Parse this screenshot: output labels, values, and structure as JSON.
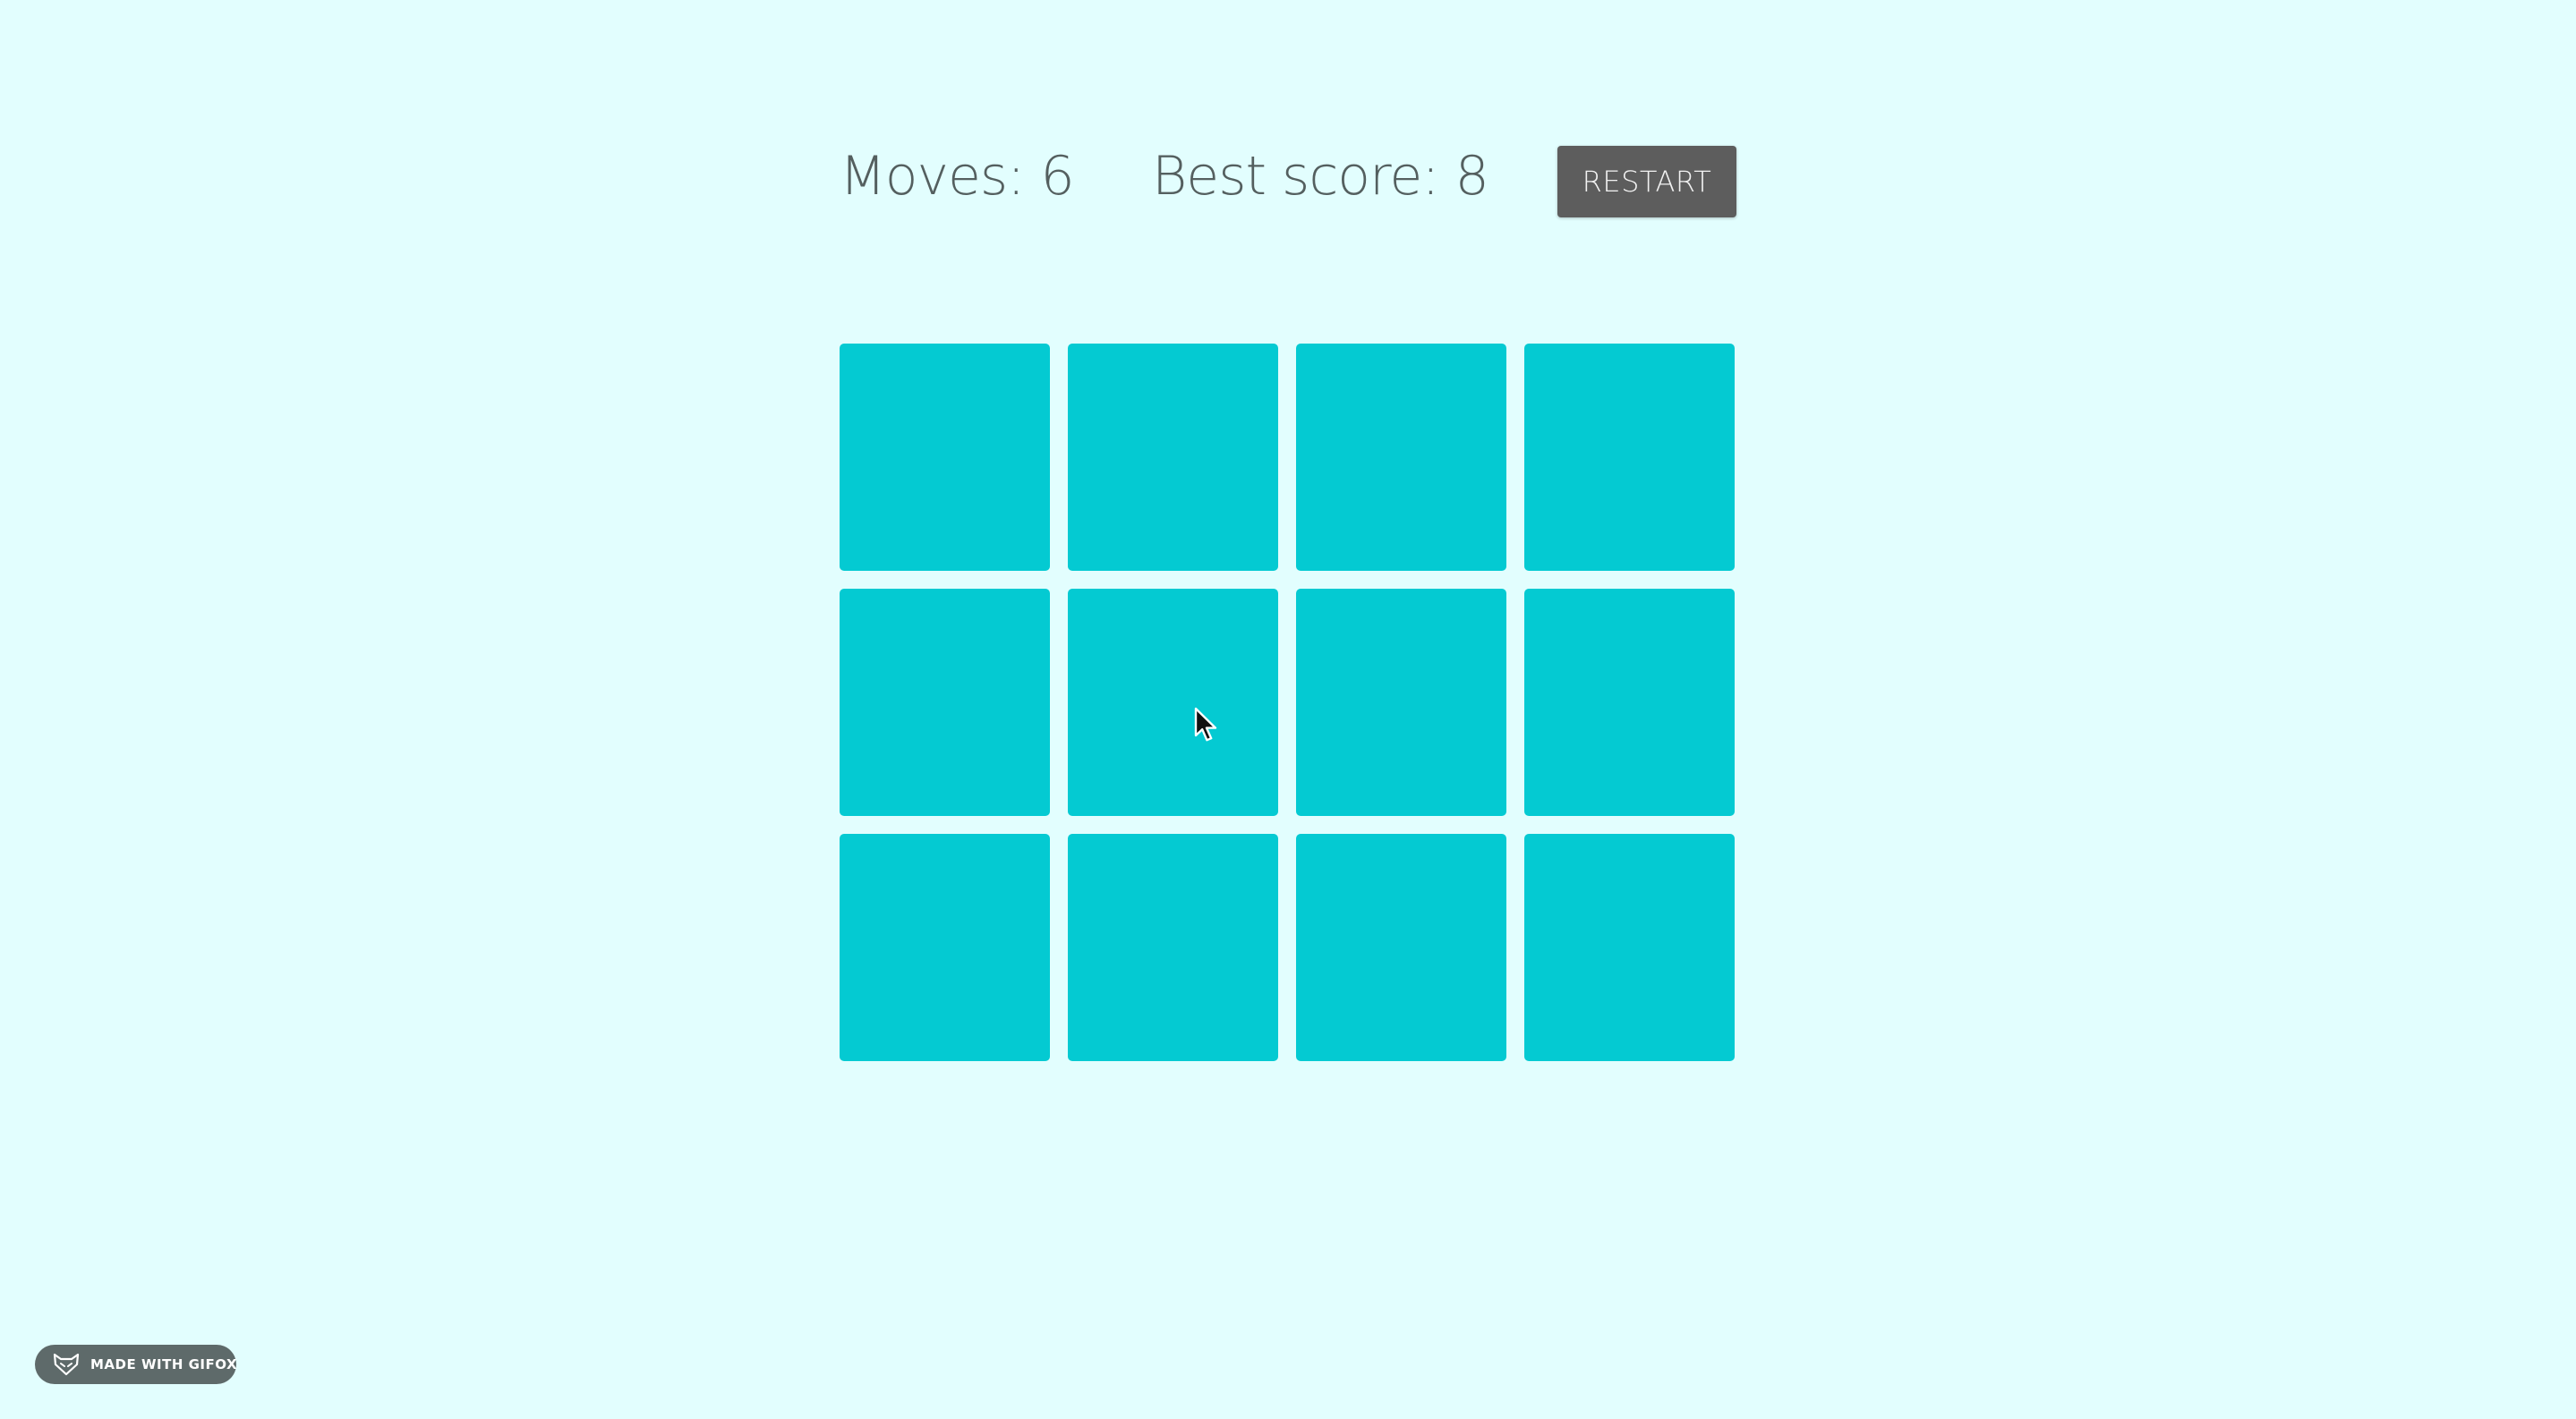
{
  "scoreboard": {
    "moves_text": "Moves: 6",
    "best_score_text": "Best score: 8",
    "restart_label": "RESTART"
  },
  "board": {
    "rows": 3,
    "columns": 4,
    "cards": [
      {
        "state": "face-down"
      },
      {
        "state": "face-down"
      },
      {
        "state": "face-down"
      },
      {
        "state": "face-down"
      },
      {
        "state": "face-down"
      },
      {
        "state": "face-down"
      },
      {
        "state": "face-down"
      },
      {
        "state": "face-down"
      },
      {
        "state": "face-down"
      },
      {
        "state": "face-down"
      },
      {
        "state": "face-down"
      },
      {
        "state": "face-down"
      }
    ]
  },
  "watermark": {
    "label": "MADE WITH GIFOX",
    "icon": "fox-icon"
  },
  "colors": {
    "background": "#e2fefe",
    "card": "#04cad2",
    "button": "#5d5d5d",
    "text": "#545f5f"
  }
}
